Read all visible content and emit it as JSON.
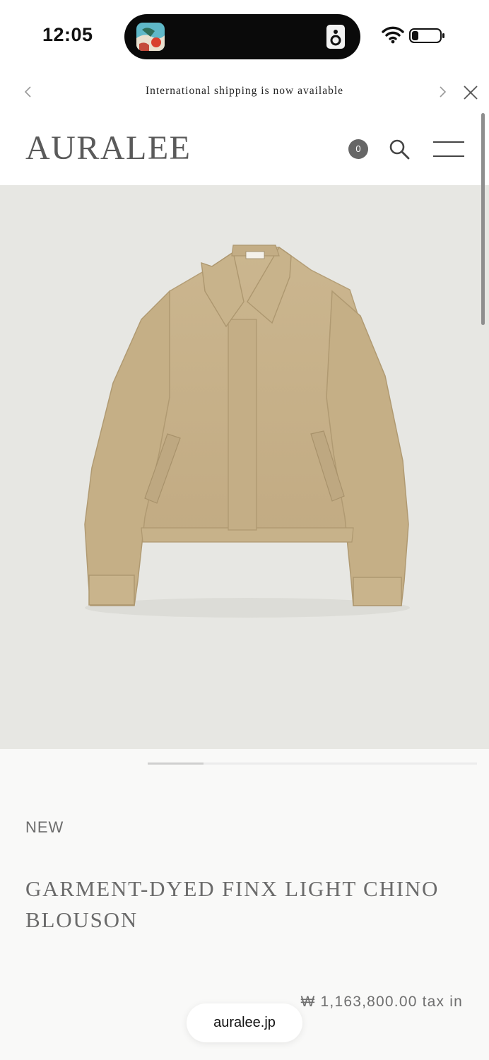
{
  "status_bar": {
    "time": "12:05",
    "battery_level": 0.2
  },
  "announcement": {
    "text": "International shipping is now available",
    "prev_icon": "chevron-left-icon",
    "next_icon": "chevron-right-icon",
    "close_icon": "close-icon"
  },
  "header": {
    "logo": "AURALEE",
    "cart_count": "0",
    "search_icon": "search-icon",
    "menu_icon": "hamburger-menu-icon"
  },
  "product": {
    "image_alt": "beige chino blouson jacket",
    "carousel_progress": 0.17,
    "tag": "NEW",
    "title": "GARMENT-DYED FINX LIGHT CHINO BLOUSON",
    "price": "₩ 1,163,800.00 tax in"
  },
  "browser": {
    "url": "auralee.jp"
  },
  "colors": {
    "hero_background": "#e7e7e3",
    "jacket": "#c7b28a",
    "logo": "#5a5a5a"
  }
}
